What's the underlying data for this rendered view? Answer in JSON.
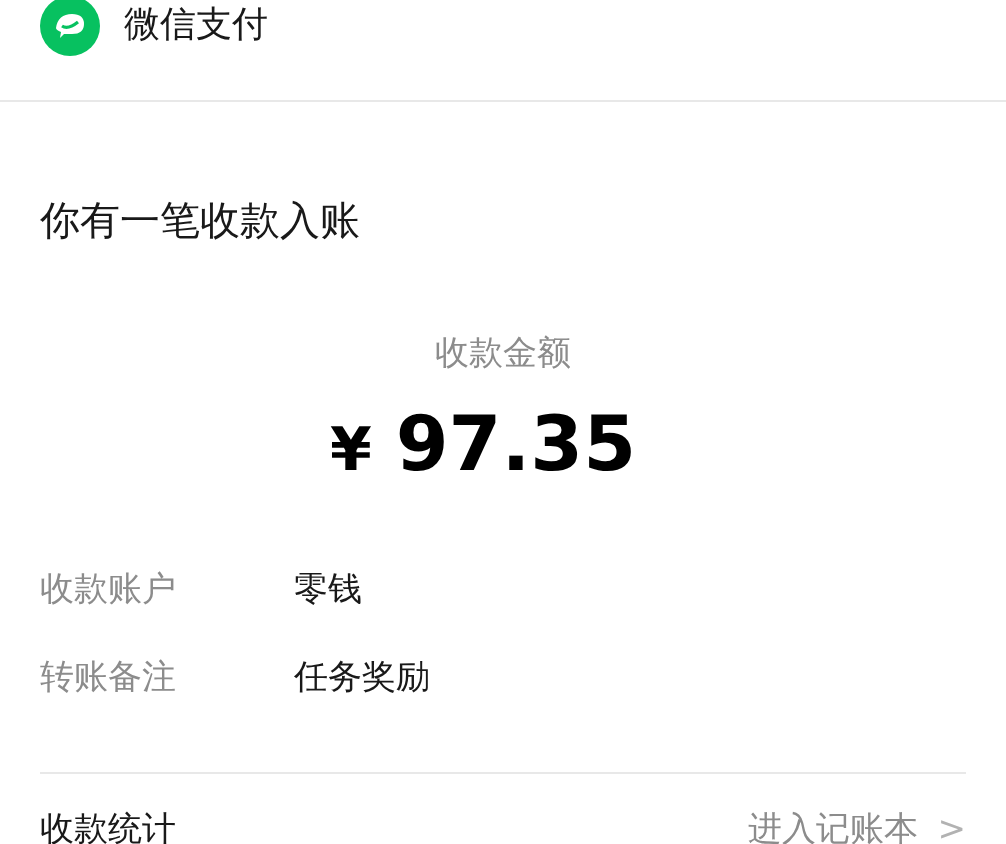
{
  "header": {
    "title": "微信支付"
  },
  "message": {
    "title": "你有一笔收款入账",
    "amount_label": "收款金额",
    "currency": "¥",
    "amount": "97.35",
    "fields": [
      {
        "label": "收款账户",
        "value": "零钱"
      },
      {
        "label": "转账备注",
        "value": "任务奖励"
      }
    ]
  },
  "footer": {
    "label": "收款统计",
    "link": "进入记账本",
    "chevron": ">"
  }
}
